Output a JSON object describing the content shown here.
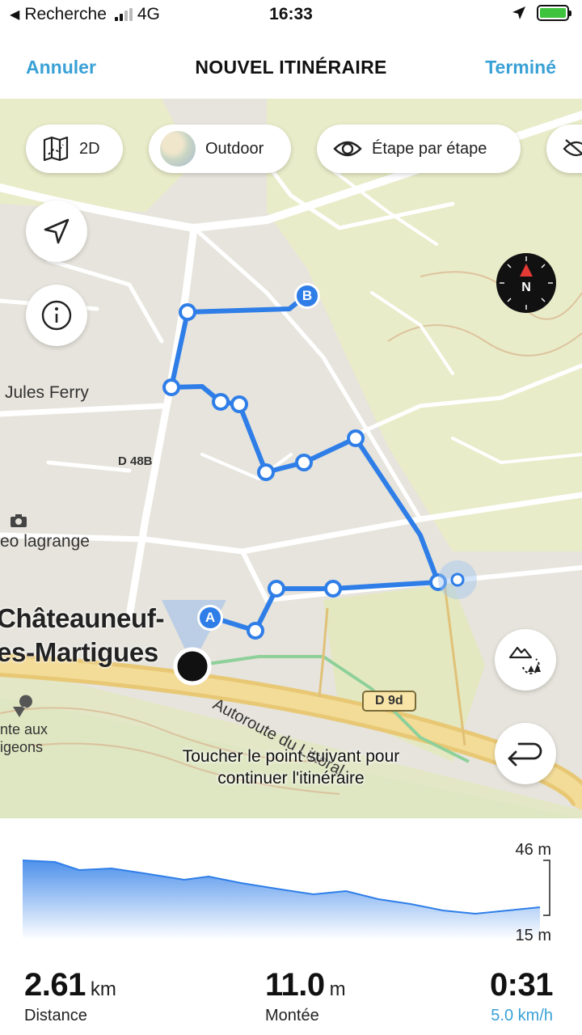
{
  "status_bar": {
    "back_label": "Recherche",
    "network": "4G",
    "time": "16:33"
  },
  "nav": {
    "cancel_label": "Annuler",
    "title": "NOUVEL ITINÉRAIRE",
    "done_label": "Terminé"
  },
  "map": {
    "mode_2d_label": "2D",
    "style_label": "Outdoor",
    "turn_by_turn_label": "Étape par étape",
    "labels": {
      "street": "Jules Ferry",
      "road_d48b": "D 48B",
      "photo_poi": "eo lagrange",
      "town_line1": "Châteauneuf-",
      "town_line2": "es-Martigues",
      "poi_line1": "nte aux",
      "poi_line2": "igeons",
      "road_d9d": "D 9d",
      "motorway": "Autoroute du Littoral"
    },
    "markers": {
      "start": "A",
      "end": "B"
    },
    "hint_line1": "Toucher le point suivant pour",
    "hint_line2": "continuer l'itinéraire",
    "compass_letter": "N",
    "route_color": "#2f7ee8"
  },
  "elevation": {
    "max_label": "46 m",
    "min_label": "15 m"
  },
  "stats": {
    "distance": {
      "value": "2.61",
      "unit": "km",
      "label": "Distance"
    },
    "climb": {
      "value": "11.0",
      "unit": "m",
      "label": "Montée"
    },
    "duration": {
      "value": "0:31",
      "speed": "5.0 km/h"
    }
  }
}
